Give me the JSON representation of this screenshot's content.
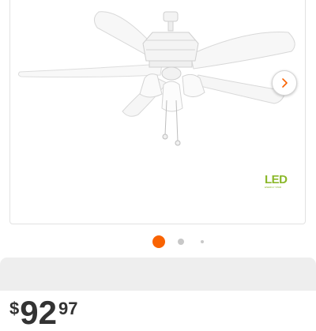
{
  "carousel": {
    "image_alt": "white five-blade ceiling fan with light kit",
    "next_icon": "chevron-right-icon",
    "slide_count": 3,
    "active_slide": 1
  },
  "badge": {
    "label": "LED",
    "sublabel": "ENERGY STAR"
  },
  "price": {
    "currency": "$",
    "dollars": "92",
    "cents": "97"
  },
  "colors": {
    "accent": "#f96302",
    "led_green": "#8bb82a",
    "text": "#333333"
  }
}
